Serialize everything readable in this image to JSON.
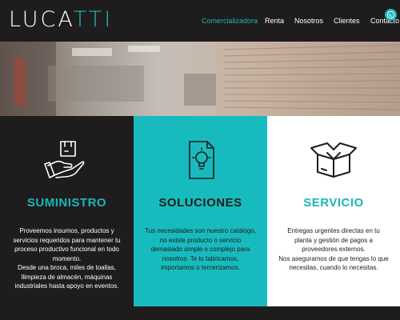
{
  "brand": {
    "logo_main": "LUCA",
    "logo_accent": "TTI"
  },
  "nav": {
    "items": [
      {
        "label": "Comercializadora",
        "active": true
      },
      {
        "label": "Renta",
        "active": false
      },
      {
        "label": "Nosotros",
        "active": false
      },
      {
        "label": "Clientes",
        "active": false
      },
      {
        "label": "Contacto",
        "active": false
      }
    ]
  },
  "colors": {
    "accent": "#1ab7b7",
    "dark": "#1e1c1c",
    "light": "#ffffff"
  },
  "columns": [
    {
      "icon": "hand-box-icon",
      "heading": "SUMINISTRO",
      "body": "Proveemos insumos, productos y servicios requeridos para mantener tu proceso productivo funcional en todo momento.\nDesde una broca, miles de toallas, llimpieza de almacén, máquinas industriales hasta apoyo en eventos."
    },
    {
      "icon": "lightbulb-document-icon",
      "heading": "SOLUCIONES",
      "body": "Tus necesidades son nuestro catálogo, no existe producto o servicio demasiado simple o complejo para nosotros. Te lo fabricamos, importamos o tercerizamos."
    },
    {
      "icon": "open-box-icon",
      "heading": "SERVICIO",
      "body": "Entregas urgentes directas en tu planta y gestión de pagos a proveedores externos.\nNos aseguramos de que tengas lo que necesitas, cuando lo necesitas."
    }
  ]
}
